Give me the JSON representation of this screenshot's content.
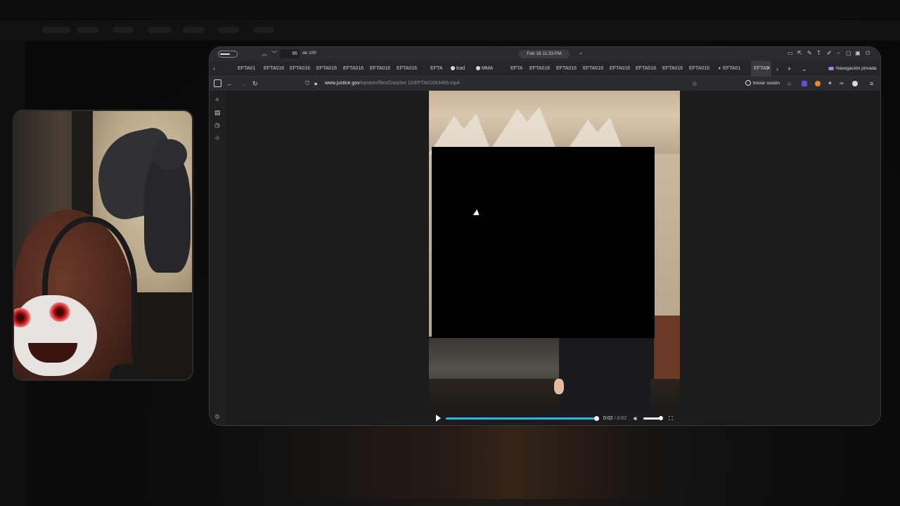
{
  "pdf_nav": {
    "current_page": "96",
    "total": "de 100"
  },
  "clock": {
    "label": "Feb 16  11:33 PM"
  },
  "tabs": [
    {
      "label": "EFTA01"
    },
    {
      "label": "EFTA016"
    },
    {
      "label": "EFTA016"
    },
    {
      "label": "EFTA016"
    },
    {
      "label": "EFTA016"
    },
    {
      "label": "EFTA016"
    },
    {
      "label": "EFTA016"
    },
    {
      "label": "EFTA"
    },
    {
      "label": "trad"
    },
    {
      "label": "MMA"
    },
    {
      "label": "EFTA"
    },
    {
      "label": "EFTA016"
    },
    {
      "label": "EFTA016"
    },
    {
      "label": "EFTA016"
    },
    {
      "label": "EFTA016"
    },
    {
      "label": "EFTA016"
    },
    {
      "label": "EFTA016"
    },
    {
      "label": "EFTA016"
    },
    {
      "label": "EFTA01"
    },
    {
      "label": "EFTA0"
    }
  ],
  "private_label": "Navegación privada",
  "url": {
    "domain": "www.justice.gov",
    "path": "/epstein/files/DataSet 10/EFTA01683486.mp4"
  },
  "signin_label": "Iniciar sesión",
  "video": {
    "current_time": "0:02",
    "duration": "0:02",
    "separator": " / ",
    "progress": 1.0,
    "volume": 0.9
  },
  "colors": {
    "accent": "#2fb2e6",
    "private": "#b37bf0"
  }
}
